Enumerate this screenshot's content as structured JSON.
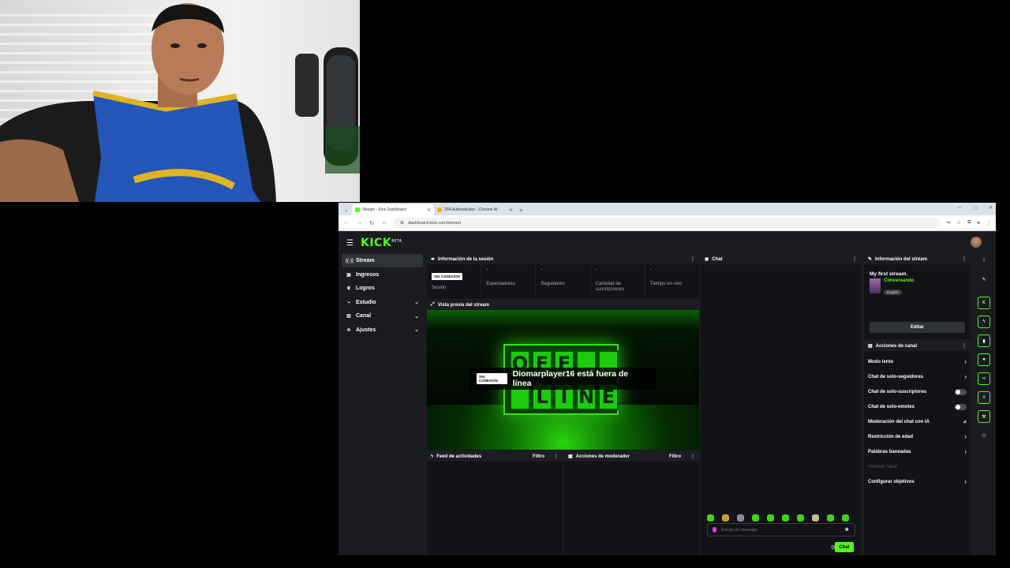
{
  "browser": {
    "tabs": [
      {
        "title": "Stream - Kick Dashboard",
        "fav_color": "#53fc18",
        "active": true
      },
      {
        "title": "2FA Authenticator - Chrome W",
        "fav_color": "#f0b000",
        "active": false
      }
    ],
    "url": "dashboard.kick.com/stream"
  },
  "kick": {
    "logo": "KICK",
    "logo_sup": "BETA",
    "sidebar": [
      {
        "label": "Stream",
        "icon": "broadcast-icon",
        "glyph": "((·))",
        "active": true,
        "chevron": false
      },
      {
        "label": "Ingresos",
        "icon": "money-icon",
        "glyph": "▣",
        "active": false,
        "chevron": false
      },
      {
        "label": "Logros",
        "icon": "trophy-icon",
        "glyph": "♛",
        "active": false,
        "chevron": false
      },
      {
        "label": "Estudio",
        "icon": "studio-icon",
        "glyph": "⌁",
        "active": false,
        "chevron": true
      },
      {
        "label": "Canal",
        "icon": "channel-icon",
        "glyph": "▤",
        "active": false,
        "chevron": true
      },
      {
        "label": "Ajustes",
        "icon": "gear-icon",
        "glyph": "✲",
        "active": false,
        "chevron": true
      }
    ],
    "session": {
      "title": "Información de la sesión",
      "badge": "SIN CONEXIÓN",
      "stats": [
        {
          "value": "",
          "label": "Sesión"
        },
        {
          "value": "-",
          "label": "Espectadores"
        },
        {
          "value": "-",
          "label": "Seguidores"
        },
        {
          "value": "-",
          "label": "Cantidad de suscripciones"
        },
        {
          "value": "-",
          "label": "Tiempo en vivo"
        }
      ]
    },
    "preview": {
      "title": "Vista previa del stream",
      "badge": "SIN CONEXIÓN",
      "offline_text": "Diomarplayer16 está fuera de línea",
      "sign_letters_top": [
        "O",
        "F",
        "F",
        "",
        ""
      ],
      "sign_letters_bottom": [
        "",
        "L",
        "I",
        "N",
        "E"
      ]
    },
    "feed": {
      "title": "Feed de actividades",
      "filter": "Filtro"
    },
    "mod_actions": {
      "title": "Acciones de moderador",
      "filter": "Filtro"
    },
    "chat": {
      "title": "Chat",
      "placeholder": "Enviar un mensaje",
      "send": "Chat",
      "emote_count": 10
    },
    "stream_info": {
      "title": "Información del stream",
      "stream_title": "My first stream.",
      "category": "Conversando",
      "tag": "English",
      "edit": "Editar"
    },
    "channel_actions": {
      "title": "Acciones de canal",
      "items": [
        {
          "label": "Modo lento",
          "control": "chevron",
          "enabled": true
        },
        {
          "label": "Chat de solo-seguidores",
          "control": "chevron",
          "enabled": true
        },
        {
          "label": "Chat de solo-suscriptores",
          "control": "toggle",
          "enabled": true
        },
        {
          "label": "Chat de solo-emotes",
          "control": "toggle",
          "enabled": true
        },
        {
          "label": "Moderación del chat con IA",
          "control": "chart",
          "enabled": true
        },
        {
          "label": "Restricción de edad",
          "control": "chevron",
          "enabled": true
        },
        {
          "label": "Palabras baneadas",
          "control": "chevron",
          "enabled": true
        },
        {
          "label": "Hostear canal",
          "control": "none",
          "enabled": false
        },
        {
          "label": "Configurar objetivos",
          "control": "chevron",
          "enabled": true
        }
      ]
    },
    "rail": [
      {
        "icon": "info-icon",
        "glyph": "i",
        "green": false
      },
      {
        "icon": "edit-icon",
        "glyph": "✎",
        "green": false
      },
      {
        "icon": "kick-icon",
        "glyph": "K",
        "green": true
      },
      {
        "icon": "bolt-icon",
        "glyph": "ϟ",
        "green": true
      },
      {
        "icon": "bookmark-icon",
        "glyph": "▮",
        "green": true
      },
      {
        "icon": "chat-bubble-icon",
        "glyph": "●",
        "green": true
      },
      {
        "icon": "link-icon",
        "glyph": "∞",
        "green": true
      },
      {
        "icon": "list-icon",
        "glyph": "≡",
        "green": true
      },
      {
        "icon": "wrench-icon",
        "glyph": "⚒",
        "green": true
      },
      {
        "icon": "group-icon",
        "glyph": "⚇",
        "green": false
      }
    ]
  }
}
